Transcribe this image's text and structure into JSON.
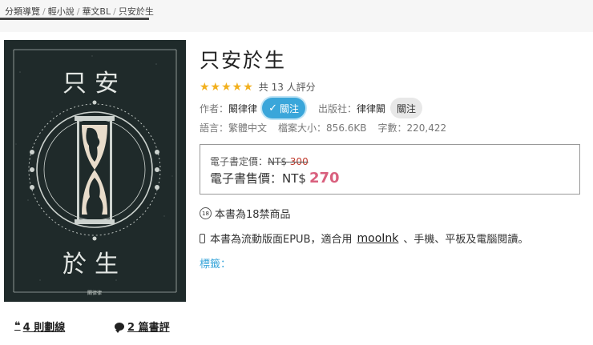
{
  "breadcrumb": {
    "items": [
      "分類導覽",
      "輕小說",
      "華文BL",
      "只安於生"
    ],
    "separator": "/"
  },
  "book": {
    "title": "只安於生",
    "cover_title_top": "只安",
    "cover_title_bottom": "於生",
    "cover_author": "闞律律",
    "rating_stars": 5,
    "rating_text": "共 13 人評分",
    "author_label": "作者：",
    "author": "闞律律",
    "follow_label": "關注",
    "publisher_label": "出版社：",
    "publisher": "律律闞",
    "publisher_follow_label": "關注",
    "language_label": "語言：",
    "language": "繁體中文",
    "filesize_label": "檔案大小：",
    "filesize": "856.6KB",
    "wordcount_label": "字數：",
    "wordcount": "220,422"
  },
  "price": {
    "orig_label": "電子書定價：",
    "orig_currency": "NT$",
    "orig_value": "300",
    "sale_label": "電子書售價：",
    "sale_currency": "NT$",
    "sale_value": "270"
  },
  "notes": {
    "adult_icon": "18-badge-icon",
    "adult_badge_text": "18",
    "adult_text": "本書為18禁商品",
    "epub_icon": "phone-icon",
    "epub_text_1": "本書為流動版面EPUB，適合用",
    "epub_link": "mooInk",
    "epub_text_2": "、手機、平板及電腦閱讀。",
    "tags_label": "標籤："
  },
  "links": {
    "highlights": "4 則劃線",
    "reviews": "2 篇書評"
  },
  "colors": {
    "star": "#f2b01e",
    "follow": "#3aa6da",
    "sale_price": "#d9607e",
    "cover_bg": "#1f2a2a"
  }
}
